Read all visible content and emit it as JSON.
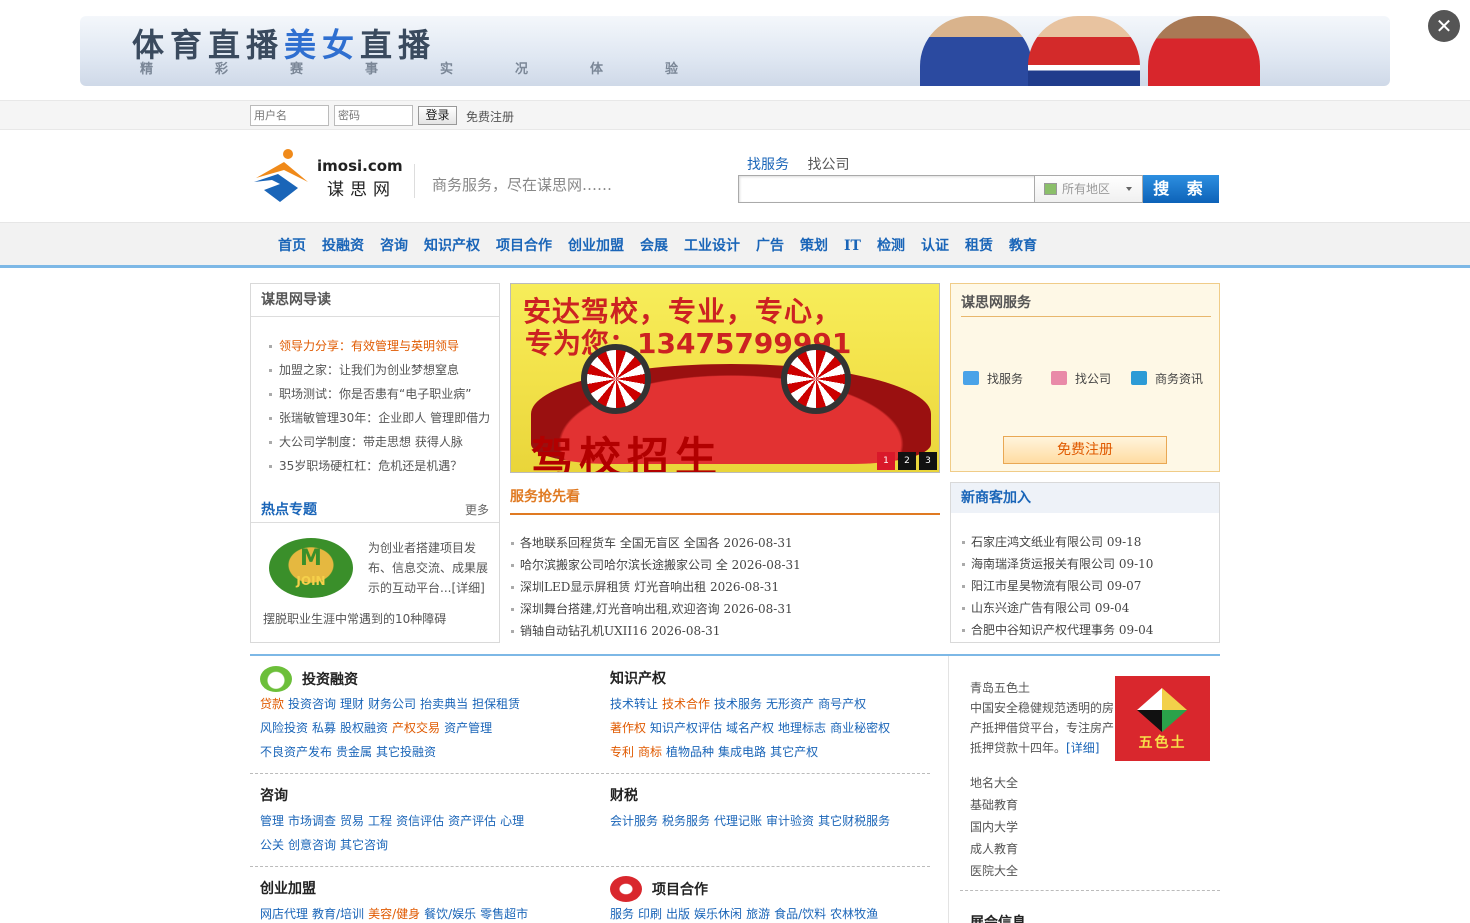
{
  "banner": {
    "title_part1": "体育直播",
    "title_part2": "美女",
    "title_part3": "直播",
    "subtitle": "精彩赛事实况体验"
  },
  "close_label": "✕",
  "login": {
    "username_placeholder": "用户名",
    "password_placeholder": "密码",
    "login_label": "登录",
    "register_label": "免费注册"
  },
  "logo": {
    "domain": "imosi.com",
    "name": "谋思网"
  },
  "slogan": "商务服务，尽在谋思网……",
  "search": {
    "tabs": [
      "找服务",
      "找公司"
    ],
    "region": "所有地区",
    "button": "搜 索"
  },
  "nav": [
    "首页",
    "投融资",
    "咨询",
    "知识产权",
    "项目合作",
    "创业加盟",
    "会展",
    "工业设计",
    "广告",
    "策划",
    "IT",
    "检测",
    "认证",
    "租赁",
    "教育"
  ],
  "guide": {
    "title": "谋思网导读",
    "items": [
      "领导力分享：有效管理与英明领导",
      "加盟之家：让我们为创业梦想窒息",
      "职场测试：你是否患有“电子职业病”",
      "张瑞敏管理30年：企业即人 管理即借力",
      "大公司学制度：带走思想 获得人脉",
      "35岁职场硬杠杠：危机还是机遇？"
    ]
  },
  "hot": {
    "title": "热点专题",
    "more": "更多",
    "logo_text": "JOIN",
    "desc": "为创业者搭建项目发布、信息交流、成果展示的互动平台...[详细]",
    "footer": "摆脱职业生涯中常遇到的10种障碍"
  },
  "slider": {
    "line1": "安达驾校，专业，专心，",
    "line2": "专为您：13475799991",
    "line3": "驾校招生",
    "dots": [
      "1",
      "2",
      "3"
    ]
  },
  "service": {
    "title": "服务抢先看",
    "items": [
      "各地联系回程货车 全国无盲区 全国各 2026-08-31",
      "哈尔滨搬家公司哈尔滨长途搬家公司 全 2026-08-31",
      "深圳LED显示屏租赁 灯光音响出租 2026-08-31",
      "深圳舞台搭建,灯光音响出租,欢迎咨询 2026-08-31",
      "销轴自动钻孔机UXII16 2026-08-31"
    ]
  },
  "svc_panel": {
    "title": "谋思网服务",
    "items": [
      "找服务",
      "找公司",
      "商务资讯"
    ],
    "free_register": "免费注册"
  },
  "newbiz": {
    "title": "新商客加入",
    "items": [
      "石家庄鸿文纸业有限公司 09-18",
      "海南瑞泽货运报关有限公司 09-10",
      "阳江市星昊物流有限公司 09-07",
      "山东兴途广告有限公司 09-04",
      "合肥中谷知识产权代理事务 09-04"
    ]
  },
  "categories": {
    "invest": {
      "title": "投资融资",
      "rows": [
        [
          "贷款",
          "投资咨询",
          "理财",
          "财务公司",
          "抬卖典当",
          "担保租赁"
        ],
        [
          "风险投资",
          "私募",
          "股权融资",
          "产权交易",
          "资产管理"
        ],
        [
          "不良资产发布",
          "贵金属",
          "其它投融资"
        ]
      ]
    },
    "ip": {
      "title": "知识产权",
      "rows": [
        [
          "技术转让",
          "技术合作",
          "技术服务",
          "无形资产",
          "商号产权"
        ],
        [
          "著作权",
          "知识产权评估",
          "域名产权",
          "地理标志",
          "商业秘密权"
        ],
        [
          "专利",
          "商标",
          "植物品种",
          "集成电路",
          "其它产权"
        ]
      ]
    },
    "consult": {
      "title": "咨询",
      "rows": [
        [
          "管理",
          "市场调查",
          "贸易",
          "工程",
          "资信评估",
          "资产评估",
          "心理"
        ],
        [
          "公关",
          "创意咨询",
          "其它咨询"
        ]
      ]
    },
    "finance": {
      "title": "财税",
      "rows": [
        [
          "会计服务",
          "税务服务",
          "代理记账",
          "审计验资",
          "其它财税服务"
        ]
      ]
    },
    "franchise": {
      "title": "创业加盟",
      "rows": [
        [
          "网店代理",
          "教育/培训",
          "美容/健身",
          "餐饮/娱乐",
          "零售超市"
        ]
      ]
    },
    "project": {
      "title": "项目合作",
      "rows": [
        [
          "服务",
          "印刷",
          "出版",
          "娱乐休闲",
          "旅游",
          "食品/饮料",
          "农林牧渔"
        ]
      ]
    }
  },
  "ad": {
    "name": "青岛五色土",
    "desc": "中国安全稳健规范透明的房产抵押借贷平台，专注房产抵押贷款十四年。",
    "more": "[详细]",
    "logo_text": "五色土"
  },
  "side_links": [
    "地名大全",
    "基础教育",
    "国内大学",
    "成人教育",
    "医院大全"
  ],
  "side_more": "展会信息"
}
